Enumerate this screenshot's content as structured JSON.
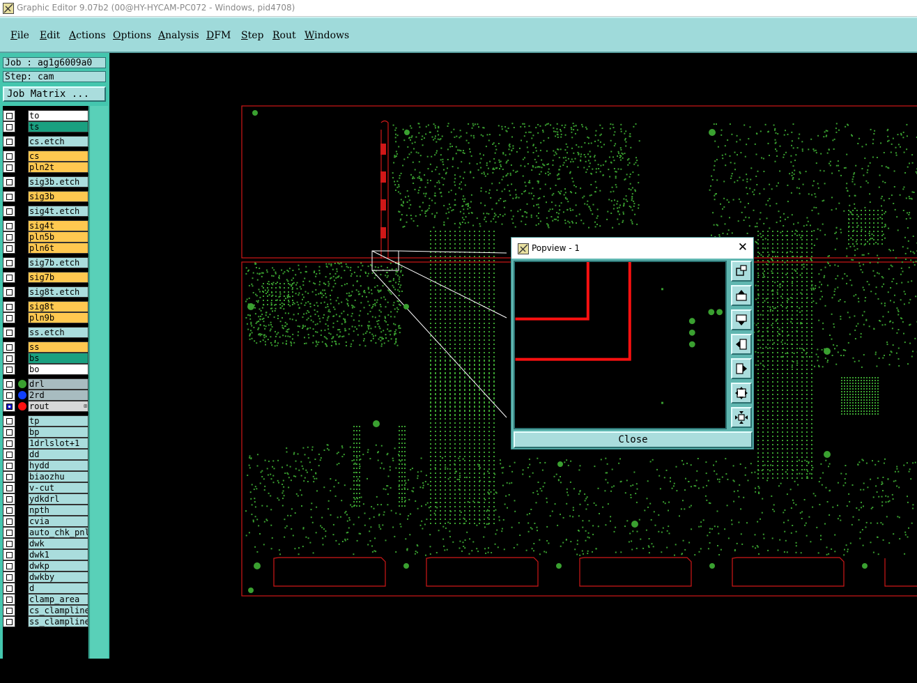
{
  "window": {
    "title": "Graphic Editor 9.07b2 (00@HY-HYCAM-PC072 - Windows, pid4708)"
  },
  "menu": [
    {
      "label": "File",
      "name": "menu-file"
    },
    {
      "label": "Edit",
      "name": "menu-edit"
    },
    {
      "label": "Actions",
      "name": "menu-actions"
    },
    {
      "label": "Options",
      "name": "menu-options"
    },
    {
      "label": "Analysis",
      "name": "menu-analysis"
    },
    {
      "label": "DFM",
      "name": "menu-dfm"
    },
    {
      "label": "Step",
      "name": "menu-step"
    },
    {
      "label": "Rout",
      "name": "menu-rout"
    },
    {
      "label": "Windows",
      "name": "menu-windows"
    }
  ],
  "job": {
    "job_label": "Job : ag1g6009a0",
    "step_label": "Step: cam",
    "job_matrix_button": "Job Matrix ..."
  },
  "layers": [
    {
      "name": "to",
      "color": "#ffffff",
      "active": false,
      "dot": ""
    },
    {
      "name": "ts",
      "color": "#1aa080",
      "active": false,
      "dot": ""
    },
    {
      "name": "cs.etch",
      "color": "#aadddd",
      "active": false,
      "dot": ""
    },
    {
      "name": "cs",
      "color": "#ffc850",
      "active": false,
      "dot": ""
    },
    {
      "name": "pln2t",
      "color": "#ffc850",
      "active": false,
      "dot": ""
    },
    {
      "name": "sig3b.etch",
      "color": "#aadddd",
      "active": false,
      "dot": ""
    },
    {
      "name": "sig3b",
      "color": "#ffc850",
      "active": false,
      "dot": ""
    },
    {
      "name": "sig4t.etch",
      "color": "#aadddd",
      "active": false,
      "dot": ""
    },
    {
      "name": "sig4t",
      "color": "#ffc850",
      "active": false,
      "dot": ""
    },
    {
      "name": "pln5b",
      "color": "#ffc850",
      "active": false,
      "dot": ""
    },
    {
      "name": "pln6t",
      "color": "#ffc850",
      "active": false,
      "dot": ""
    },
    {
      "name": "sig7b.etch",
      "color": "#aadddd",
      "active": false,
      "dot": ""
    },
    {
      "name": "sig7b",
      "color": "#ffc850",
      "active": false,
      "dot": ""
    },
    {
      "name": "sig8t.etch",
      "color": "#aadddd",
      "active": false,
      "dot": ""
    },
    {
      "name": "sig8t",
      "color": "#ffc850",
      "active": false,
      "dot": ""
    },
    {
      "name": "pln9b",
      "color": "#ffc850",
      "active": false,
      "dot": ""
    },
    {
      "name": "ss.etch",
      "color": "#aadddd",
      "active": false,
      "dot": ""
    },
    {
      "name": "ss",
      "color": "#ffc850",
      "active": false,
      "dot": ""
    },
    {
      "name": "bs",
      "color": "#1aa080",
      "active": false,
      "dot": ""
    },
    {
      "name": "bo",
      "color": "#ffffff",
      "active": false,
      "dot": ""
    },
    {
      "name": "drl",
      "color": "#a8bcc0",
      "active": false,
      "dot": "#3aa030"
    },
    {
      "name": "2rd",
      "color": "#a8bcc0",
      "active": false,
      "dot": "#1040ff"
    },
    {
      "name": "rout",
      "color": "#d8d8d8",
      "active": true,
      "dot": "#ff1010"
    },
    {
      "name": "tp",
      "color": "#aadddd",
      "active": false,
      "dot": ""
    },
    {
      "name": "bp",
      "color": "#aadddd",
      "active": false,
      "dot": ""
    },
    {
      "name": "1drlslot+1",
      "color": "#aadddd",
      "active": false,
      "dot": ""
    },
    {
      "name": "dd",
      "color": "#aadddd",
      "active": false,
      "dot": ""
    },
    {
      "name": "hydd",
      "color": "#aadddd",
      "active": false,
      "dot": ""
    },
    {
      "name": "biaozhu",
      "color": "#aadddd",
      "active": false,
      "dot": ""
    },
    {
      "name": "v-cut",
      "color": "#aadddd",
      "active": false,
      "dot": ""
    },
    {
      "name": "ydkdrl",
      "color": "#aadddd",
      "active": false,
      "dot": ""
    },
    {
      "name": "npth",
      "color": "#aadddd",
      "active": false,
      "dot": ""
    },
    {
      "name": "cvia",
      "color": "#aadddd",
      "active": false,
      "dot": ""
    },
    {
      "name": "auto_chk_pnl",
      "color": "#aadddd",
      "active": false,
      "dot": ""
    },
    {
      "name": "dwk",
      "color": "#aadddd",
      "active": false,
      "dot": ""
    },
    {
      "name": "dwk1",
      "color": "#aadddd",
      "active": false,
      "dot": ""
    },
    {
      "name": "dwkp",
      "color": "#aadddd",
      "active": false,
      "dot": ""
    },
    {
      "name": "dwkby",
      "color": "#aadddd",
      "active": false,
      "dot": ""
    },
    {
      "name": "d",
      "color": "#aadddd",
      "active": false,
      "dot": ""
    },
    {
      "name": "clamp_area",
      "color": "#aadddd",
      "active": false,
      "dot": ""
    },
    {
      "name": "cs_clampline",
      "color": "#aadddd",
      "active": false,
      "dot": ""
    },
    {
      "name": "ss_clampline",
      "color": "#aadddd",
      "active": false,
      "dot": ""
    }
  ],
  "popview": {
    "title": "Popview - 1",
    "close_x": "✕",
    "close_button": "Close",
    "tools": [
      {
        "name": "zoom-window-icon"
      },
      {
        "name": "pan-up-icon"
      },
      {
        "name": "pan-down-icon"
      },
      {
        "name": "pan-left-icon"
      },
      {
        "name": "pan-right-icon"
      },
      {
        "name": "zoom-in-icon"
      },
      {
        "name": "zoom-out-icon"
      }
    ]
  },
  "colors": {
    "menu_bg": "#9fdada",
    "panel_bg": "#44c6ae",
    "board_outline": "#d01818",
    "copper": "#3aa030",
    "rout": "#ff1010"
  }
}
